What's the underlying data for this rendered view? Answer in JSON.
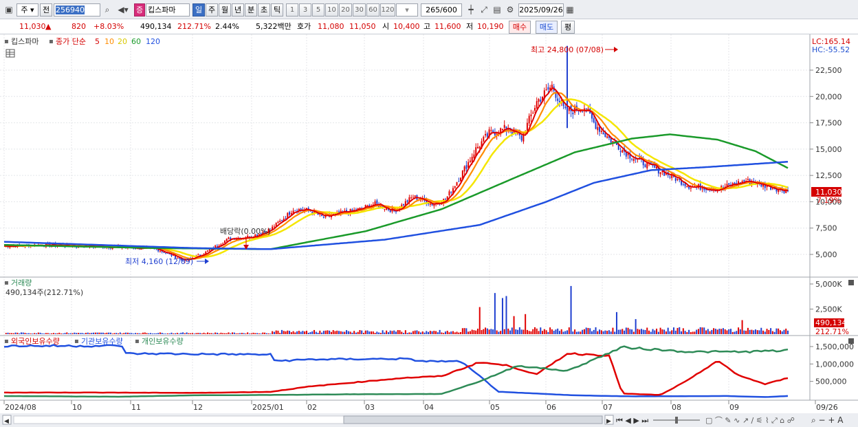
{
  "toolbar": {
    "market_select": "주",
    "prev_label": "전",
    "stock_code": "256940",
    "search_icon": "search-icon",
    "sound_icon": "speaker-icon",
    "badge": "증",
    "stock_name": "킵스파마",
    "periods": [
      "일",
      "주",
      "월",
      "년",
      "분",
      "초",
      "틱"
    ],
    "active_period": "일",
    "intervals": [
      "1",
      "3",
      "5",
      "10",
      "20",
      "30",
      "60",
      "120"
    ],
    "count_current": "265",
    "count_max": "/600",
    "date": "2025/09/26",
    "calendar_icon": "calendar-icon"
  },
  "quote": {
    "price": "11,030",
    "change_arrow": "▲",
    "change": "820",
    "change_pct": "+8.03%",
    "volume": "490,134",
    "volume_ratio": "212.71%",
    "turnover": "2.44%",
    "amount": "5,322백만",
    "ask_label": "호가",
    "ask": "11,080",
    "bid": "11,050",
    "open_label": "시",
    "open": "10,400",
    "high_label": "고",
    "high": "11,600",
    "low_label": "저",
    "low": "10,190",
    "buy_label": "매수",
    "sell_label": "매도",
    "avg_label": "평"
  },
  "colors": {
    "candle_up": "#e00000",
    "candle_down": "#1f3fd0",
    "ma5": "#e00000",
    "ma10": "#ff8c00",
    "ma20": "#f5e600",
    "ma60": "#1a9a2a",
    "ma120": "#2050e0",
    "foreign": "#e00000",
    "institution": "#2050e0",
    "individual": "#2e8b57"
  },
  "chart_data": [
    {
      "type": "candlestick",
      "title": "킵스파마",
      "legend": {
        "label": "종가 단순",
        "periods": [
          "5",
          "10",
          "20",
          "60",
          "120"
        ]
      },
      "y_ticks": [
        "22,500",
        "20,000",
        "17,500",
        "15,000",
        "12,500",
        "10,000",
        "7,500",
        "5,000"
      ],
      "y_tick_values": [
        22500,
        20000,
        17500,
        15000,
        12500,
        10000,
        7500,
        5000
      ],
      "ylim": [
        3000,
        25500
      ],
      "lc": "LC:165.14",
      "hc": "HC:-55.52",
      "last_price": "11,030",
      "last_pct": "7.19%",
      "annotations": {
        "high": "최고 24,800 (07/08)",
        "low": "최저 4,160 (12/09)",
        "dividend": "배당락(0.00%)"
      },
      "x_labels": [
        "2024/08",
        "10",
        "11",
        "12",
        "2025/01",
        "02",
        "03",
        "04",
        "05",
        "06",
        "07",
        "08",
        "09",
        "09/26"
      ],
      "approx_close": [
        [
          0,
          5800
        ],
        [
          20,
          5900
        ],
        [
          40,
          5800
        ],
        [
          60,
          5700
        ],
        [
          80,
          5500
        ],
        [
          95,
          4400
        ],
        [
          105,
          5100
        ],
        [
          118,
          6500
        ],
        [
          130,
          6700
        ],
        [
          140,
          7400
        ],
        [
          148,
          8600
        ],
        [
          152,
          9300
        ],
        [
          160,
          9200
        ],
        [
          168,
          8500
        ],
        [
          176,
          8900
        ],
        [
          185,
          9200
        ],
        [
          195,
          9800
        ],
        [
          205,
          9100
        ],
        [
          215,
          10500
        ],
        [
          225,
          9800
        ],
        [
          232,
          10200
        ],
        [
          240,
          12500
        ],
        [
          248,
          15000
        ],
        [
          255,
          16500
        ],
        [
          265,
          17000
        ],
        [
          272,
          16000
        ],
        [
          280,
          19500
        ],
        [
          288,
          21000
        ],
        [
          295,
          18500
        ],
        [
          305,
          19000
        ],
        [
          310,
          17500
        ],
        [
          318,
          16000
        ],
        [
          328,
          14500
        ],
        [
          338,
          13500
        ],
        [
          350,
          12500
        ],
        [
          360,
          11500
        ],
        [
          375,
          11200
        ],
        [
          390,
          12000
        ],
        [
          405,
          11300
        ],
        [
          412,
          11030
        ]
      ],
      "ma60_points": [
        [
          0,
          5900
        ],
        [
          80,
          5600
        ],
        [
          140,
          5500
        ],
        [
          190,
          7200
        ],
        [
          230,
          9300
        ],
        [
          270,
          12400
        ],
        [
          300,
          14700
        ],
        [
          330,
          16000
        ],
        [
          350,
          16400
        ],
        [
          375,
          15900
        ],
        [
          395,
          14800
        ],
        [
          412,
          13200
        ]
      ],
      "ma120_points": [
        [
          0,
          6200
        ],
        [
          100,
          5600
        ],
        [
          140,
          5500
        ],
        [
          200,
          6400
        ],
        [
          250,
          7800
        ],
        [
          285,
          10000
        ],
        [
          310,
          11800
        ],
        [
          340,
          13000
        ],
        [
          370,
          13300
        ],
        [
          412,
          13800
        ]
      ]
    },
    {
      "type": "bar",
      "title": "거래량",
      "summary": "490,134주(212.71%)",
      "y_ticks": [
        "5,000K",
        "2,500K"
      ],
      "y_tick_values": [
        5000,
        2500
      ],
      "last_value": "490,134",
      "last_pct": "212.71%",
      "unit": "K",
      "peaks": [
        [
          258,
          4100
        ],
        [
          262,
          3600
        ],
        [
          264,
          3800
        ],
        [
          268,
          4900
        ],
        [
          274,
          2000
        ],
        [
          268,
          1800
        ],
        [
          298,
          4800
        ],
        [
          322,
          2200
        ],
        [
          332,
          1500
        ],
        [
          388,
          1400
        ],
        [
          250,
          2700
        ]
      ]
    },
    {
      "type": "line",
      "series_names": [
        "외국인보유수량",
        "기관보유수량",
        "개인보유수량"
      ],
      "y_ticks": [
        "1,500,000",
        "1,000,000",
        "500,000"
      ],
      "y_tick_values": [
        1500000,
        1000000,
        500000
      ]
    }
  ]
}
